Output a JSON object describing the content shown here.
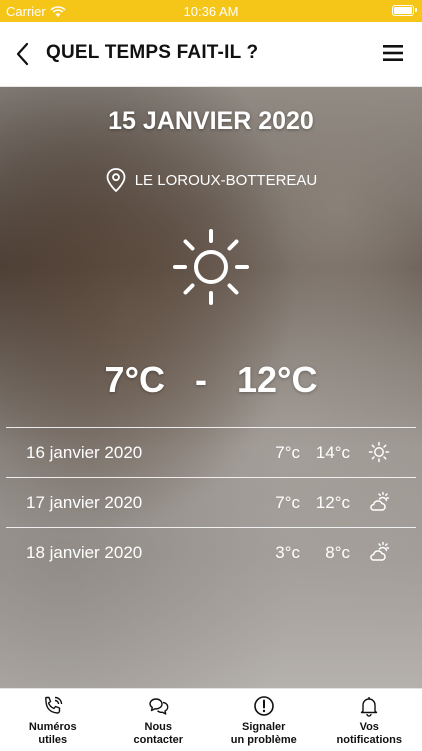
{
  "status_bar": {
    "carrier": "Carrier",
    "time": "10:36 AM"
  },
  "header": {
    "title": "QUEL TEMPS FAIT-IL ?"
  },
  "weather": {
    "date": "15 JANVIER 2020",
    "location": "LE LOROUX-BOTTEREAU",
    "condition_icon": "sun-icon",
    "temp_min": "7°C",
    "temp_max": "12°C",
    "separator": "-"
  },
  "forecast": [
    {
      "date": "16 janvier 2020",
      "min": "7°c",
      "max": "14°c",
      "icon": "sun-icon"
    },
    {
      "date": "17 janvier 2020",
      "min": "7°c",
      "max": "12°c",
      "icon": "partly-cloudy-icon"
    },
    {
      "date": "18 janvier 2020",
      "min": "3°c",
      "max": "8°c",
      "icon": "partly-cloudy-icon"
    }
  ],
  "tabs": [
    {
      "label": "Numéros\nutiles",
      "icon": "phone-icon"
    },
    {
      "label": "Nous\ncontacter",
      "icon": "chat-icon"
    },
    {
      "label": "Signaler\nun problème",
      "icon": "alert-icon"
    },
    {
      "label": "Vos\nnotifications",
      "icon": "bell-icon"
    }
  ],
  "colors": {
    "status_bar": "#f5c518",
    "text_on_image": "#ffffff"
  }
}
